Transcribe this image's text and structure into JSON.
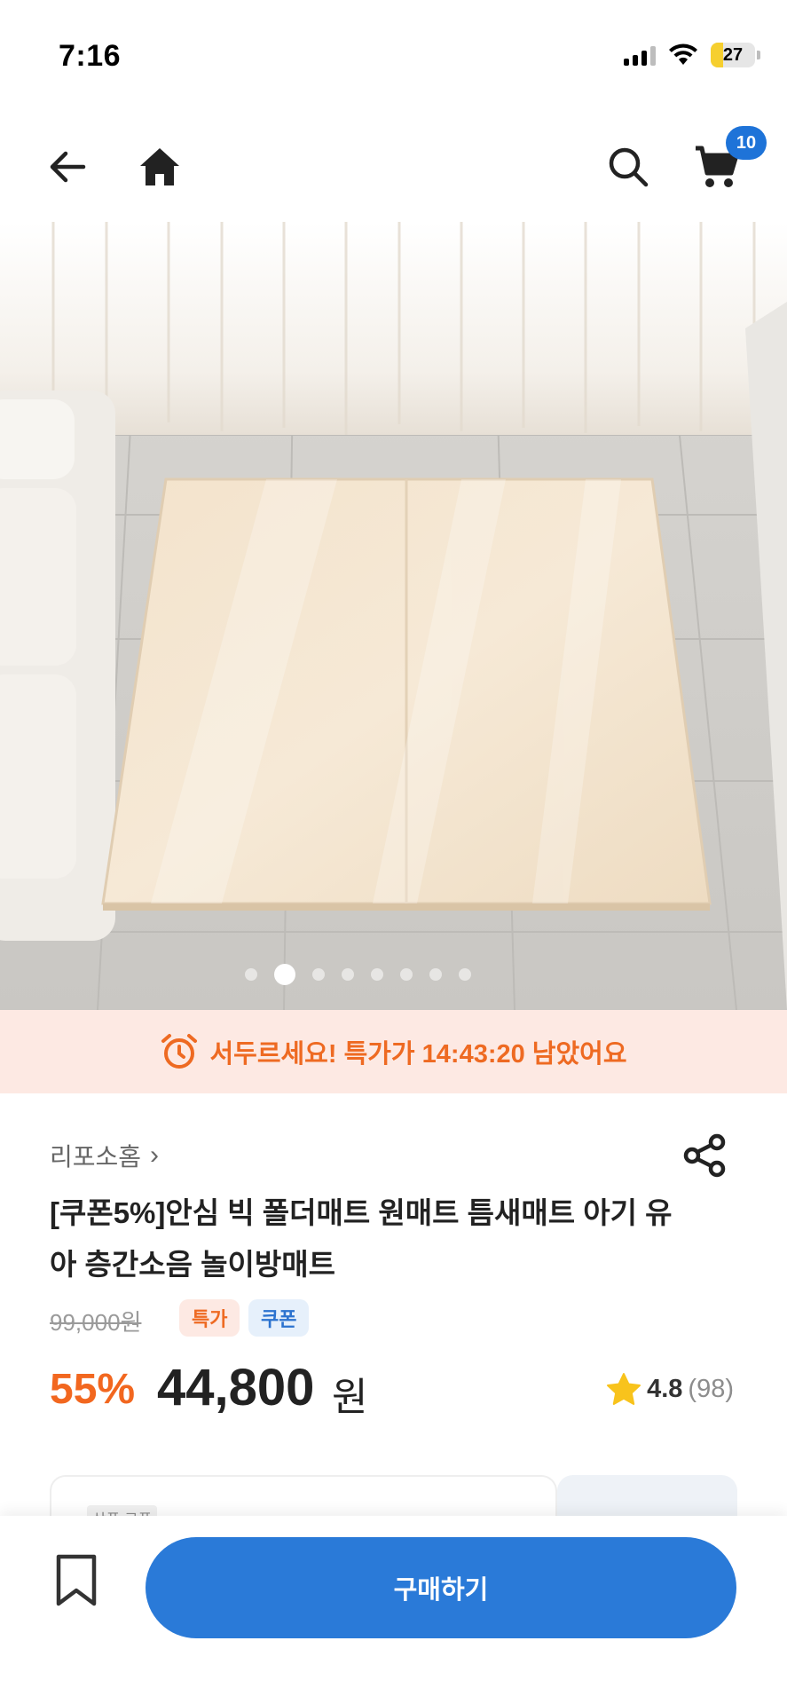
{
  "status_bar": {
    "time": "7:16",
    "battery": "27",
    "battery_level": 0.27,
    "signal_icon": "cellular-signal-icon",
    "wifi_icon": "wifi-icon"
  },
  "nav": {
    "back_icon": "arrow-left-icon",
    "home_icon": "home-icon",
    "search_icon": "search-icon",
    "cart_icon": "shopping-cart-icon",
    "cart_count": "10"
  },
  "gallery": {
    "image": "folding-play-mat-photo",
    "total_images": 8,
    "active_index": 1
  },
  "promo_timer": {
    "icon": "alarm-clock-icon",
    "text": "서두르세요! 특가가 14:43:20 남았어요"
  },
  "product": {
    "store_name": "리포소홈",
    "store_chevron": "›",
    "share_icon": "share-icon",
    "title": "[쿠폰5%]안심 빅 폴더매트 원매트 틈새매트 아기 유아 층간소음 놀이방매트",
    "original_price": "99,000원",
    "badge_sale": "특가",
    "badge_coupon": "쿠폰",
    "discount_rate": "55%",
    "price": "44,800",
    "currency": "원",
    "rating_icon": "star-icon",
    "rating": "4.8",
    "review_count": "(98)"
  },
  "coupon_section": {
    "label": "상품 쿠폰"
  },
  "bottom_bar": {
    "bookmark_icon": "bookmark-icon",
    "buy_label": "구매하기"
  },
  "colors": {
    "accent_blue": "#2a7ad8",
    "discount_orange": "#f2671f",
    "timer_bg": "#fde9e3",
    "star_yellow": "#f8c31c"
  }
}
